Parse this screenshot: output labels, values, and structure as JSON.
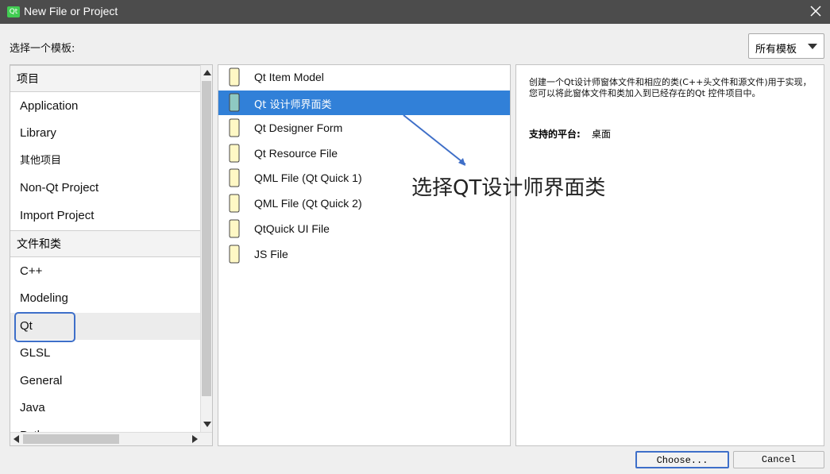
{
  "window": {
    "title": "New File or Project"
  },
  "template_prompt": "选择一个模板:",
  "filter": {
    "selected": "所有模板"
  },
  "category_groups": [
    {
      "header": "项目",
      "items": [
        "Application",
        "Library",
        "其他项目",
        "Non-Qt Project",
        "Import Project"
      ]
    },
    {
      "header": "文件和类",
      "items": [
        "C++",
        "Modeling",
        "Qt",
        "GLSL",
        "General",
        "Java",
        "Python"
      ]
    }
  ],
  "selected_category": "Qt",
  "templates": [
    "Qt Item Model",
    "Qt 设计师界面类",
    "Qt Designer Form",
    "Qt Resource File",
    "QML File (Qt Quick 1)",
    "QML File (Qt Quick 2)",
    "QtQuick UI File",
    "JS File"
  ],
  "selected_template": "Qt 设计师界面类",
  "description": {
    "text": "创建一个Qt设计师窗体文件和相应的类(C++头文件和源文件)用于实现，您可以将此窗体文件和类加入到已经存在的Qt 控件项目中。",
    "platforms_label": "支持的平台:",
    "platforms_value": "桌面"
  },
  "annotation": "选择QT设计师界面类",
  "buttons": {
    "choose": "Choose...",
    "cancel": "Cancel"
  }
}
